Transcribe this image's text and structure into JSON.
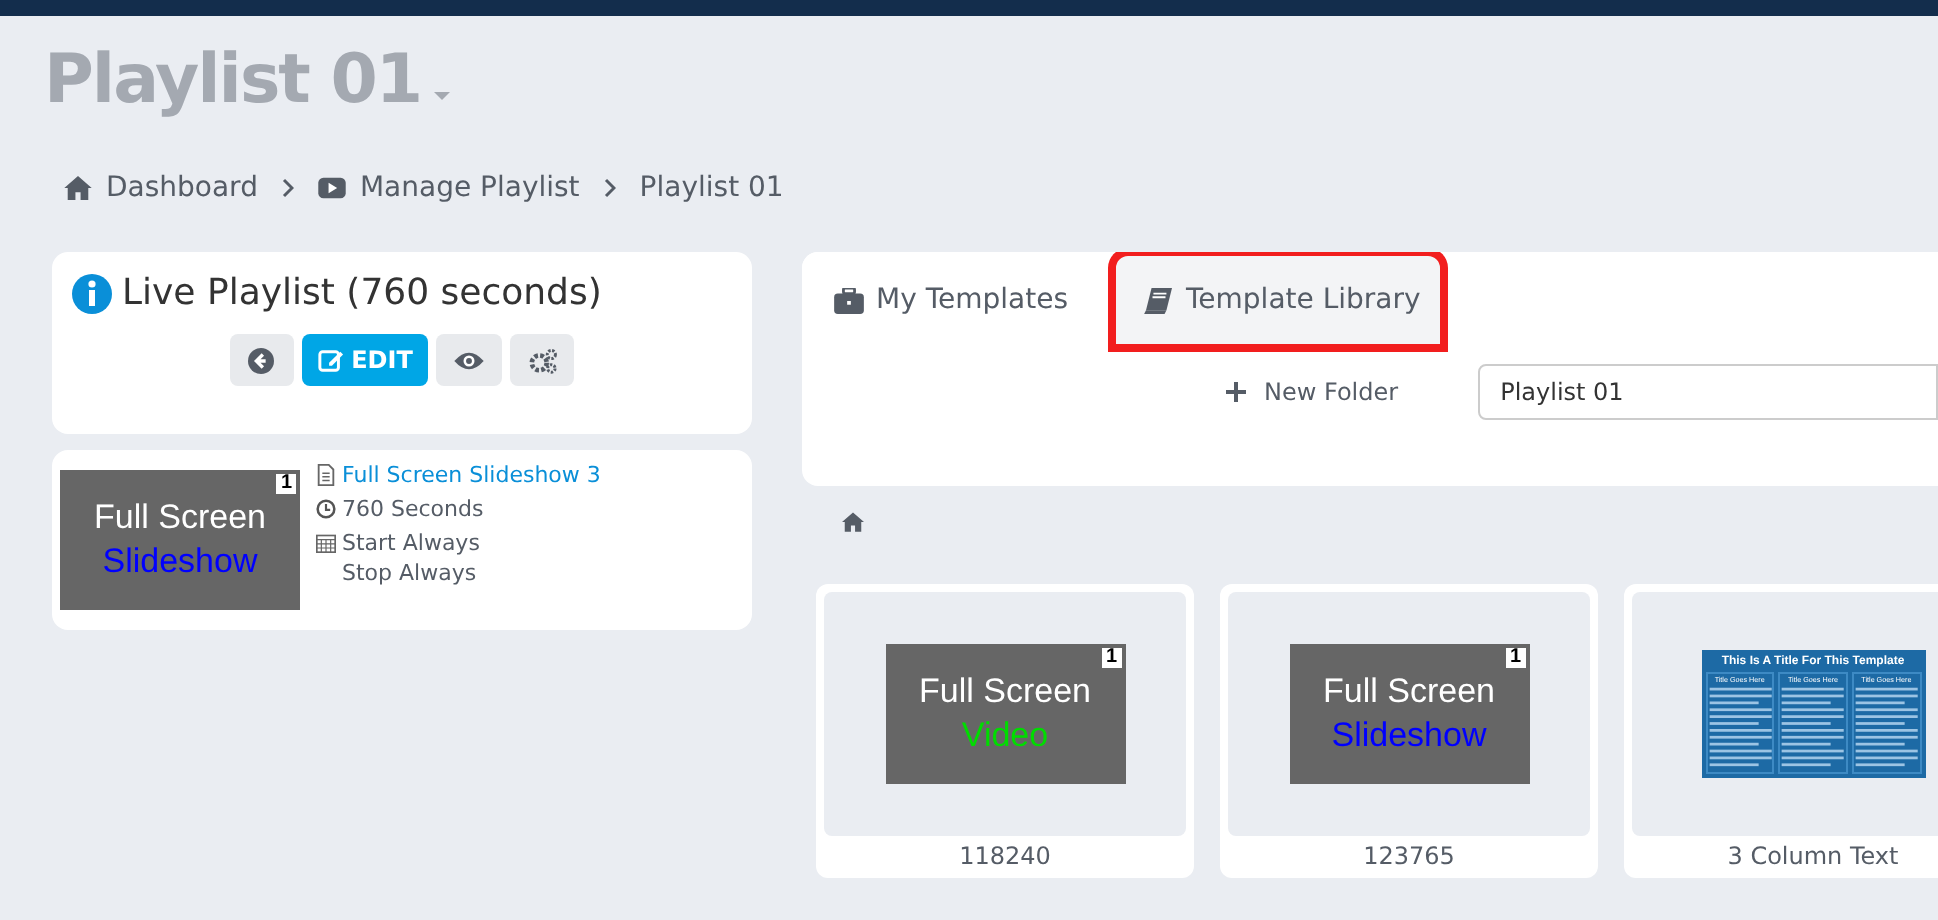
{
  "page_title": "Playlist 01",
  "breadcrumb": [
    {
      "label": "Dashboard",
      "kind": "home"
    },
    {
      "label": "Manage Playlist",
      "kind": "video"
    },
    {
      "label": "Playlist 01",
      "kind": "page"
    }
  ],
  "playlist": {
    "title": "Live Playlist (760 seconds)",
    "buttons": [
      {
        "kind": "back"
      },
      {
        "kind": "edit",
        "label": "EDIT"
      },
      {
        "kind": "view"
      },
      {
        "kind": "settings"
      }
    ],
    "items": [
      {
        "thumb": {
          "line1": "Full Screen",
          "line2": "Slideshow",
          "color": "#0000ff",
          "badge": "1"
        },
        "name": "Full Screen Slideshow 3",
        "duration": "760 Seconds",
        "start": "Start Always",
        "stop": "Stop Always"
      }
    ]
  },
  "tabs": [
    {
      "label": "My Templates",
      "kind": "mine",
      "selected": true,
      "highlighted": false
    },
    {
      "label": "Template Library",
      "kind": "library",
      "selected": false,
      "highlighted": true
    }
  ],
  "new_folder": "New Folder",
  "folder_field": {
    "value": "Playlist 01"
  },
  "templates": [
    {
      "kind": "text",
      "line1": "Full Screen",
      "line2": "Video",
      "color": "#00dd00",
      "badge": "1",
      "label": "118240"
    },
    {
      "kind": "text",
      "line1": "Full Screen",
      "line2": "Slideshow",
      "color": "#0000ff",
      "badge": "1",
      "label": "123765"
    },
    {
      "kind": "columns",
      "title": "This Is A Title For This Template",
      "headings": [
        "Title Goes Here",
        "Title Goes Here",
        "Title Goes Here"
      ],
      "label": "3 Column Text"
    }
  ]
}
